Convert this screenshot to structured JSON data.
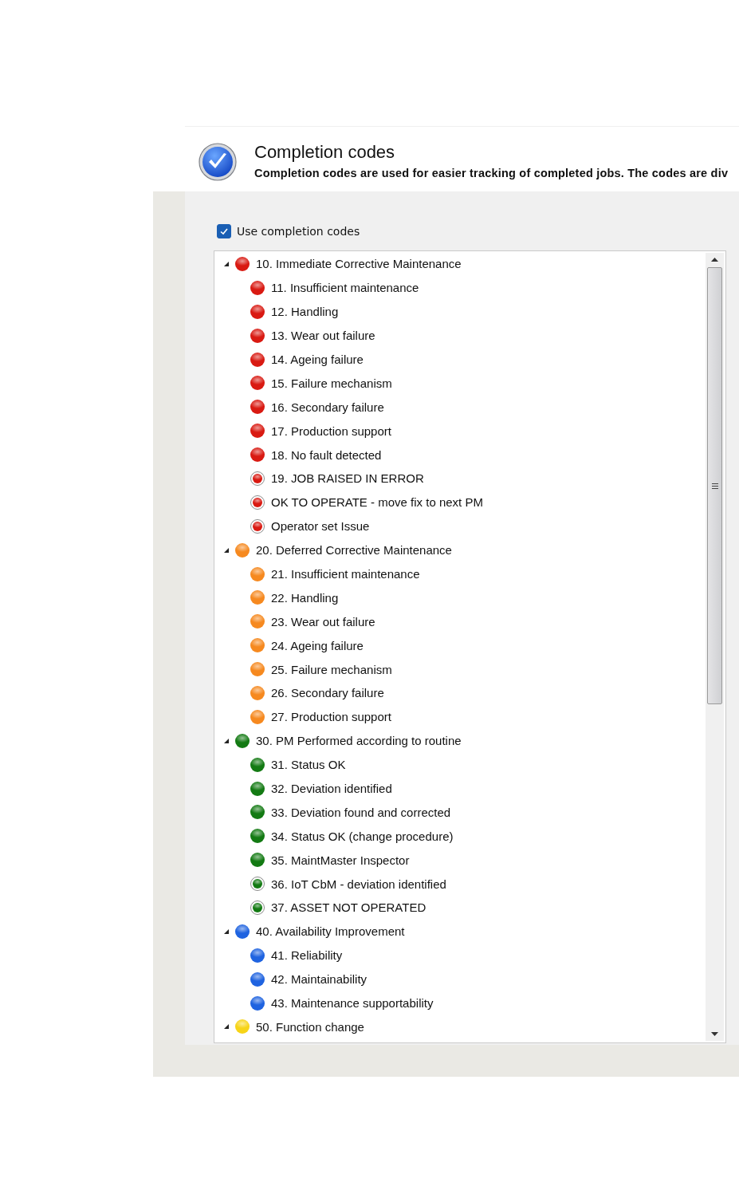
{
  "header": {
    "title": "Completion codes",
    "description": "Completion codes are used for easier tracking of completed jobs. The codes are div"
  },
  "use_codes": {
    "label": "Use completion codes",
    "checked": true
  },
  "tree": [
    {
      "label": "10. Immediate Corrective Maintenance",
      "color": "#d91a12",
      "expanded": true,
      "children": [
        {
          "label": "11. Insufficient maintenance",
          "color": "#d91a12",
          "kind": "dot"
        },
        {
          "label": "12. Handling",
          "color": "#d91a12",
          "kind": "dot"
        },
        {
          "label": "13. Wear out failure",
          "color": "#d91a12",
          "kind": "dot"
        },
        {
          "label": "14. Ageing failure",
          "color": "#d91a12",
          "kind": "dot"
        },
        {
          "label": "15. Failure mechanism",
          "color": "#d91a12",
          "kind": "dot"
        },
        {
          "label": "16. Secondary failure",
          "color": "#d91a12",
          "kind": "dot"
        },
        {
          "label": "17. Production support",
          "color": "#d91a12",
          "kind": "dot"
        },
        {
          "label": "18. No fault detected",
          "color": "#d91a12",
          "kind": "dot"
        },
        {
          "label": "19. JOB RAISED IN ERROR",
          "color": "#d91a12",
          "kind": "ringed"
        },
        {
          "label": "OK TO OPERATE - move fix to next PM",
          "color": "#d91a12",
          "kind": "ringed"
        },
        {
          "label": "Operator set Issue",
          "color": "#d91a12",
          "kind": "ringed"
        }
      ]
    },
    {
      "label": "20. Deferred Corrective Maintenance",
      "color": "#f6891f",
      "expanded": true,
      "children": [
        {
          "label": "21. Insufficient maintenance",
          "color": "#f6891f",
          "kind": "dot"
        },
        {
          "label": "22. Handling",
          "color": "#f6891f",
          "kind": "dot"
        },
        {
          "label": "23. Wear out failure",
          "color": "#f6891f",
          "kind": "dot"
        },
        {
          "label": "24. Ageing failure",
          "color": "#f6891f",
          "kind": "dot"
        },
        {
          "label": "25. Failure mechanism",
          "color": "#f6891f",
          "kind": "dot"
        },
        {
          "label": "26. Secondary failure",
          "color": "#f6891f",
          "kind": "dot"
        },
        {
          "label": "27. Production support",
          "color": "#f6891f",
          "kind": "dot"
        }
      ]
    },
    {
      "label": "30. PM Performed according to routine",
      "color": "#137a13",
      "expanded": true,
      "children": [
        {
          "label": "31. Status OK",
          "color": "#137a13",
          "kind": "dot"
        },
        {
          "label": "32. Deviation identified",
          "color": "#137a13",
          "kind": "dot"
        },
        {
          "label": "33. Deviation found and corrected",
          "color": "#137a13",
          "kind": "dot"
        },
        {
          "label": "34. Status OK (change procedure)",
          "color": "#137a13",
          "kind": "dot"
        },
        {
          "label": "35. MaintMaster Inspector",
          "color": "#137a13",
          "kind": "dot"
        },
        {
          "label": "36. IoT CbM - deviation identified",
          "color": "#137a13",
          "kind": "ringed"
        },
        {
          "label": "37. ASSET NOT OPERATED",
          "color": "#137a13",
          "kind": "ringed"
        }
      ]
    },
    {
      "label": "40. Availability Improvement",
      "color": "#1f63e0",
      "expanded": true,
      "children": [
        {
          "label": "41. Reliability",
          "color": "#1f63e0",
          "kind": "dot"
        },
        {
          "label": "42. Maintainability",
          "color": "#1f63e0",
          "kind": "dot"
        },
        {
          "label": "43. Maintenance supportability",
          "color": "#1f63e0",
          "kind": "dot"
        }
      ]
    },
    {
      "label": "50. Function change",
      "color": "#f7d417",
      "expanded": true
    }
  ]
}
